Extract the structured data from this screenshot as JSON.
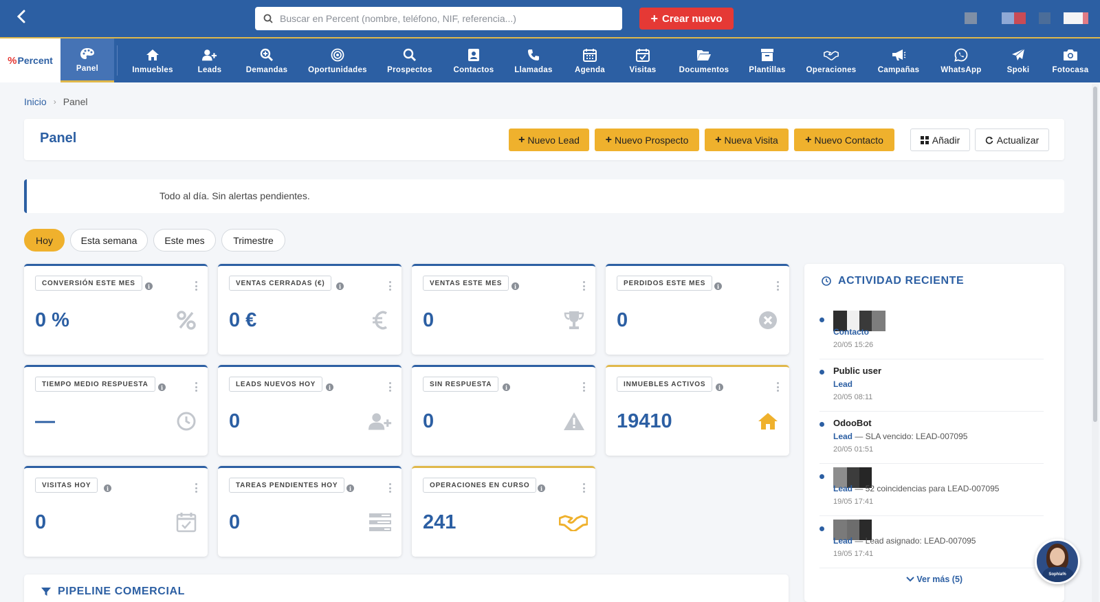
{
  "topbar": {
    "search_placeholder": "Buscar en Percent (nombre, teléfono, NIF, referencia...)",
    "create_label": "Crear nuevo"
  },
  "brand": {
    "name": "Percent"
  },
  "nav": [
    {
      "label": "Panel",
      "icon": "palette-icon",
      "active": true
    },
    {
      "label": "Inmuebles",
      "icon": "home-icon"
    },
    {
      "label": "Leads",
      "icon": "user-plus-icon"
    },
    {
      "label": "Demandas",
      "icon": "search-plus-icon"
    },
    {
      "label": "Oportunidades",
      "icon": "target-icon"
    },
    {
      "label": "Prospectos",
      "icon": "search-icon"
    },
    {
      "label": "Contactos",
      "icon": "contact-card-icon"
    },
    {
      "label": "Llamadas",
      "icon": "phone-icon"
    },
    {
      "label": "Agenda",
      "icon": "calendar-icon"
    },
    {
      "label": "Visitas",
      "icon": "calendar-check-icon"
    },
    {
      "label": "Documentos",
      "icon": "folder-open-icon"
    },
    {
      "label": "Plantillas",
      "icon": "archive-icon"
    },
    {
      "label": "Operaciones",
      "icon": "handshake-icon"
    },
    {
      "label": "Campañas",
      "icon": "megaphone-icon"
    },
    {
      "label": "WhatsApp",
      "icon": "whatsapp-icon"
    },
    {
      "label": "Spoki",
      "icon": "paper-plane-icon"
    },
    {
      "label": "Fotocasa",
      "icon": "camera-icon"
    }
  ],
  "breadcrumb": {
    "home": "Inicio",
    "current": "Panel"
  },
  "header": {
    "title": "Panel",
    "buttons": {
      "nuevo_lead": "Nuevo Lead",
      "nuevo_prospecto": "Nuevo Prospecto",
      "nueva_visita": "Nueva Visita",
      "nuevo_contacto": "Nuevo Contacto",
      "anadir": "Añadir",
      "actualizar": "Actualizar"
    }
  },
  "alert": {
    "text": "Todo al día. Sin alertas pendientes."
  },
  "periods": [
    "Hoy",
    "Esta semana",
    "Este mes",
    "Trimestre"
  ],
  "kpis": [
    {
      "label": "CONVERSIÓN ESTE MES",
      "value": "0 %",
      "icon": "percent-icon"
    },
    {
      "label": "VENTAS CERRADAS (€)",
      "value": "0 €",
      "icon": "euro-icon"
    },
    {
      "label": "VENTAS ESTE MES",
      "value": "0",
      "icon": "trophy-icon"
    },
    {
      "label": "PERDIDOS ESTE MES",
      "value": "0",
      "icon": "times-circle-icon"
    },
    {
      "label": "TIEMPO MEDIO RESPUESTA",
      "value": "—",
      "icon": "clock-icon"
    },
    {
      "label": "LEADS NUEVOS HOY",
      "value": "0",
      "icon": "user-plus-icon"
    },
    {
      "label": "SIN RESPUESTA",
      "value": "0",
      "icon": "warning-icon"
    },
    {
      "label": "INMUEBLES ACTIVOS",
      "value": "19410",
      "icon": "home-icon"
    },
    {
      "label": "VISITAS HOY",
      "value": "0",
      "icon": "calendar-check-icon"
    },
    {
      "label": "TAREAS PENDIENTES HOY",
      "value": "0",
      "icon": "tasks-icon"
    },
    {
      "label": "OPERACIONES EN CURSO",
      "value": "241",
      "icon": "handshake-icon"
    }
  ],
  "activity": {
    "title": "ACTIVIDAD RECIENTE",
    "items": [
      {
        "name": "",
        "type": "Contacto",
        "desc": "",
        "time": "20/05 15:26"
      },
      {
        "name": "Public user",
        "type": "Lead",
        "desc": "",
        "time": "20/05 08:11"
      },
      {
        "name": "OdooBot",
        "type": "Lead",
        "desc": " — SLA vencido: LEAD-007095",
        "time": "20/05 01:51"
      },
      {
        "name": "",
        "type": "Lead",
        "desc": " — 52 coincidencias para LEAD-007095",
        "time": "19/05 17:41"
      },
      {
        "name": "",
        "type": "Lead",
        "desc": " — Lead asignado: LEAD-007095",
        "time": "19/05 17:41"
      }
    ],
    "more": "Ver más (5)"
  },
  "pipeline": {
    "title": "PIPELINE COMERCIAL"
  },
  "assistant": {
    "name": "Sophia%"
  }
}
